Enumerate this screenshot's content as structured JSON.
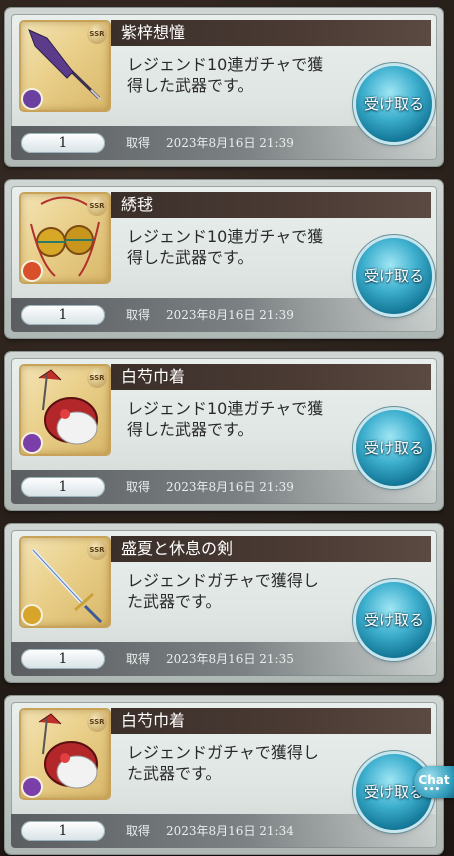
{
  "cards": [
    {
      "title": "紫梓想憧",
      "description_line1": "レジェンド10連ガチャで獲",
      "description_line2": "得した武器です。",
      "quantity": "1",
      "acquire_label": "取得",
      "acquire_date": "2023年8月16日 21:39",
      "receive_label": "受け取る",
      "rarity_badge": "SSR",
      "element_color": "#6b3fa0",
      "item_icon": "spear-icon"
    },
    {
      "title": "綉毬",
      "description_line1": "レジェンド10連ガチャで獲",
      "description_line2": "得した武器です。",
      "quantity": "1",
      "acquire_label": "取得",
      "acquire_date": "2023年8月16日 21:39",
      "receive_label": "受け取る",
      "rarity_badge": "SSR",
      "element_color": "#d8502a",
      "item_icon": "embroidered-ball-icon"
    },
    {
      "title": "白芍巾着",
      "description_line1": "レジェンド10連ガチャで獲",
      "description_line2": "得した武器です。",
      "quantity": "1",
      "acquire_label": "取得",
      "acquire_date": "2023年8月16日 21:39",
      "receive_label": "受け取る",
      "rarity_badge": "SSR",
      "element_color": "#7a3fa8",
      "item_icon": "pouch-icon"
    },
    {
      "title": "盛夏と休息の剣",
      "description_line1": "レジェンドガチャで獲得し",
      "description_line2": "た武器です。",
      "quantity": "1",
      "acquire_label": "取得",
      "acquire_date": "2023年8月16日 21:35",
      "receive_label": "受け取る",
      "rarity_badge": "SSR",
      "element_color": "#d6a52a",
      "item_icon": "sword-icon"
    },
    {
      "title": "白芍巾着",
      "description_line1": "レジェンドガチャで獲得し",
      "description_line2": "た武器です。",
      "quantity": "1",
      "acquire_label": "取得",
      "acquire_date": "2023年8月16日 21:34",
      "receive_label": "受け取る",
      "rarity_badge": "SSR",
      "element_color": "#7a3fa8",
      "item_icon": "pouch-icon"
    }
  ],
  "chat_button_label": "Chat"
}
